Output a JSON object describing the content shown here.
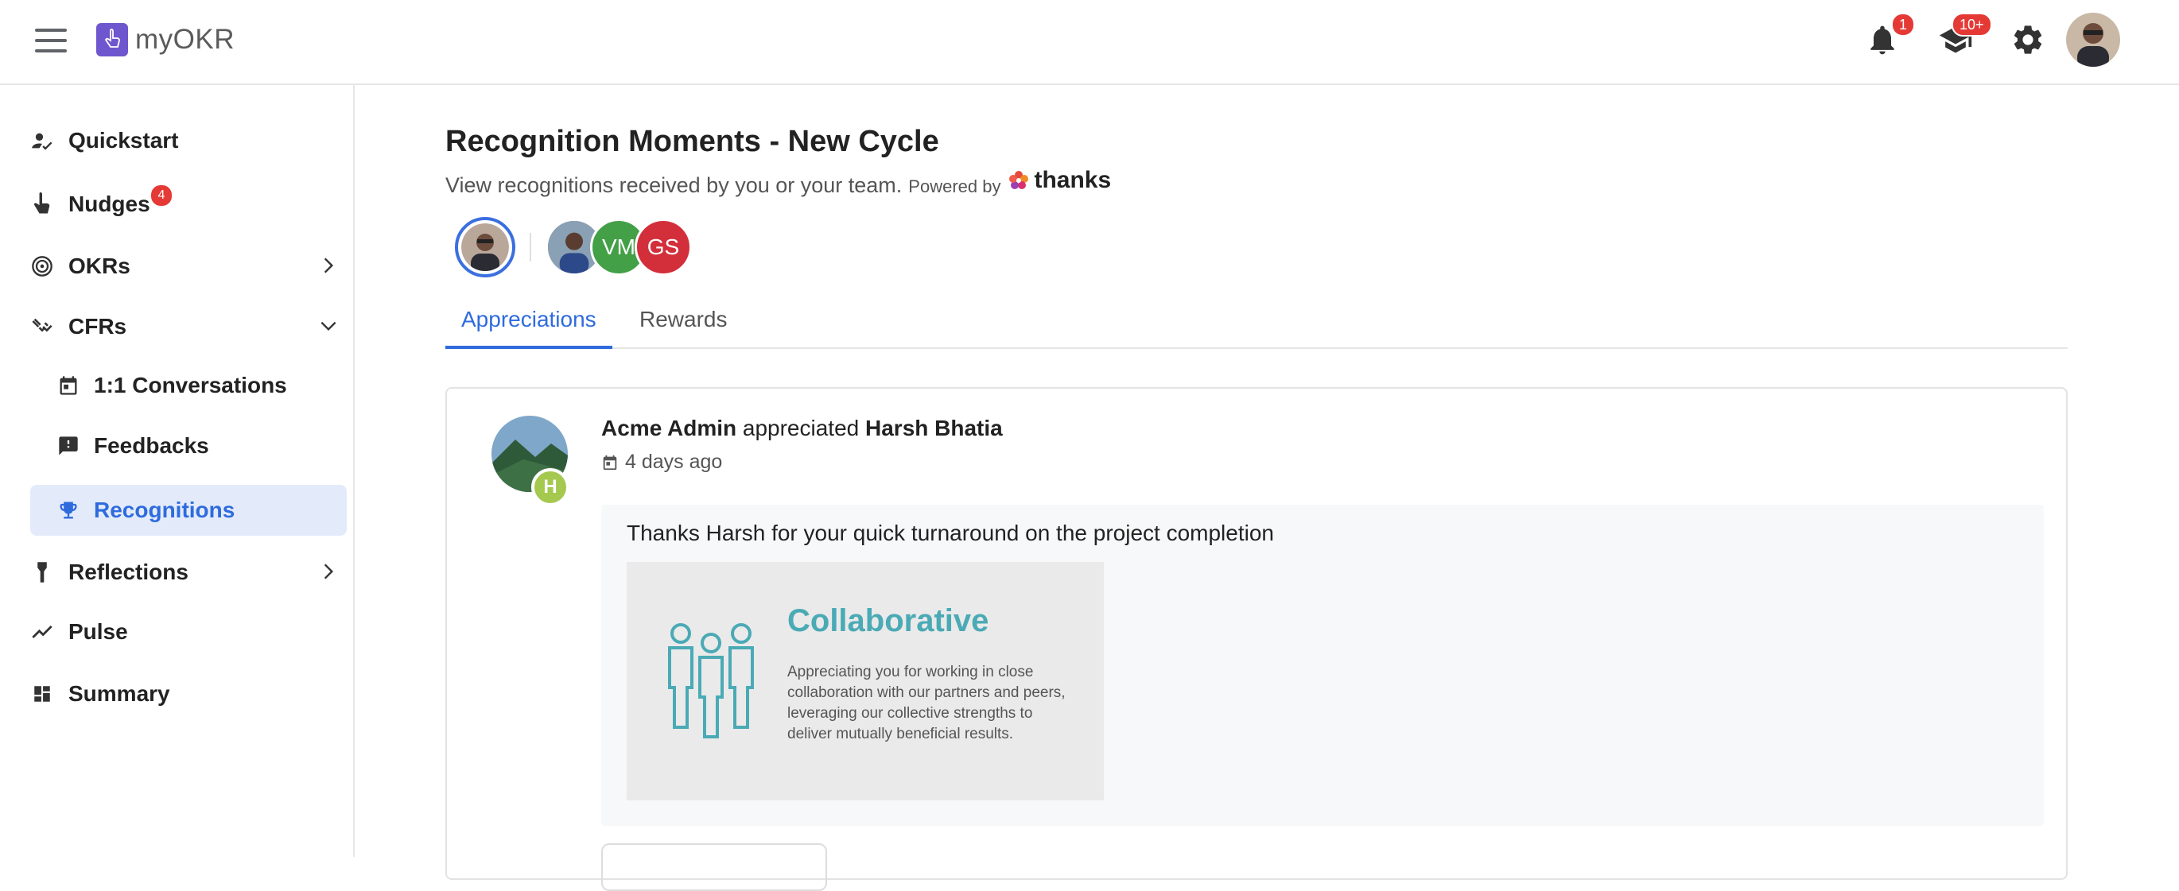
{
  "app": {
    "name": "myOKR"
  },
  "header": {
    "notifications_badge": "1",
    "learning_badge": "10+"
  },
  "sidebar": {
    "items": [
      {
        "label": "Quickstart"
      },
      {
        "label": "Nudges",
        "badge": "4"
      },
      {
        "label": "OKRs"
      },
      {
        "label": "CFRs"
      },
      {
        "label": "1:1 Conversations"
      },
      {
        "label": "Feedbacks"
      },
      {
        "label": "Recognitions"
      },
      {
        "label": "Reflections"
      },
      {
        "label": "Pulse"
      },
      {
        "label": "Summary"
      }
    ]
  },
  "main": {
    "title": "Recognition Moments - New Cycle",
    "subtitle": "View recognitions received by you or your team.",
    "powered_by": "Powered by",
    "powered_brand": "thanks",
    "team_avatars": [
      {
        "initials": "VM",
        "color": "#43a047"
      },
      {
        "initials": "GS",
        "color": "#d32f3b"
      }
    ],
    "tabs": [
      {
        "label": "Appreciations",
        "active": true
      },
      {
        "label": "Rewards",
        "active": false
      }
    ],
    "recognition": {
      "giver": "Acme Admin",
      "verb": "appreciated",
      "receiver": "Harsh Bhatia",
      "time": "4 days ago",
      "avatar_initial": "H",
      "message": "Thanks Harsh for your quick turnaround on the project completion",
      "card_title": "Collaborative",
      "card_desc": "Appreciating you for working in close collaboration with our partners and peers, leveraging our collective strengths to deliver mutually beneficial results."
    }
  },
  "colors": {
    "accent": "#2f6bdd",
    "brand": "#6e56cf",
    "badge": "#e53935"
  }
}
